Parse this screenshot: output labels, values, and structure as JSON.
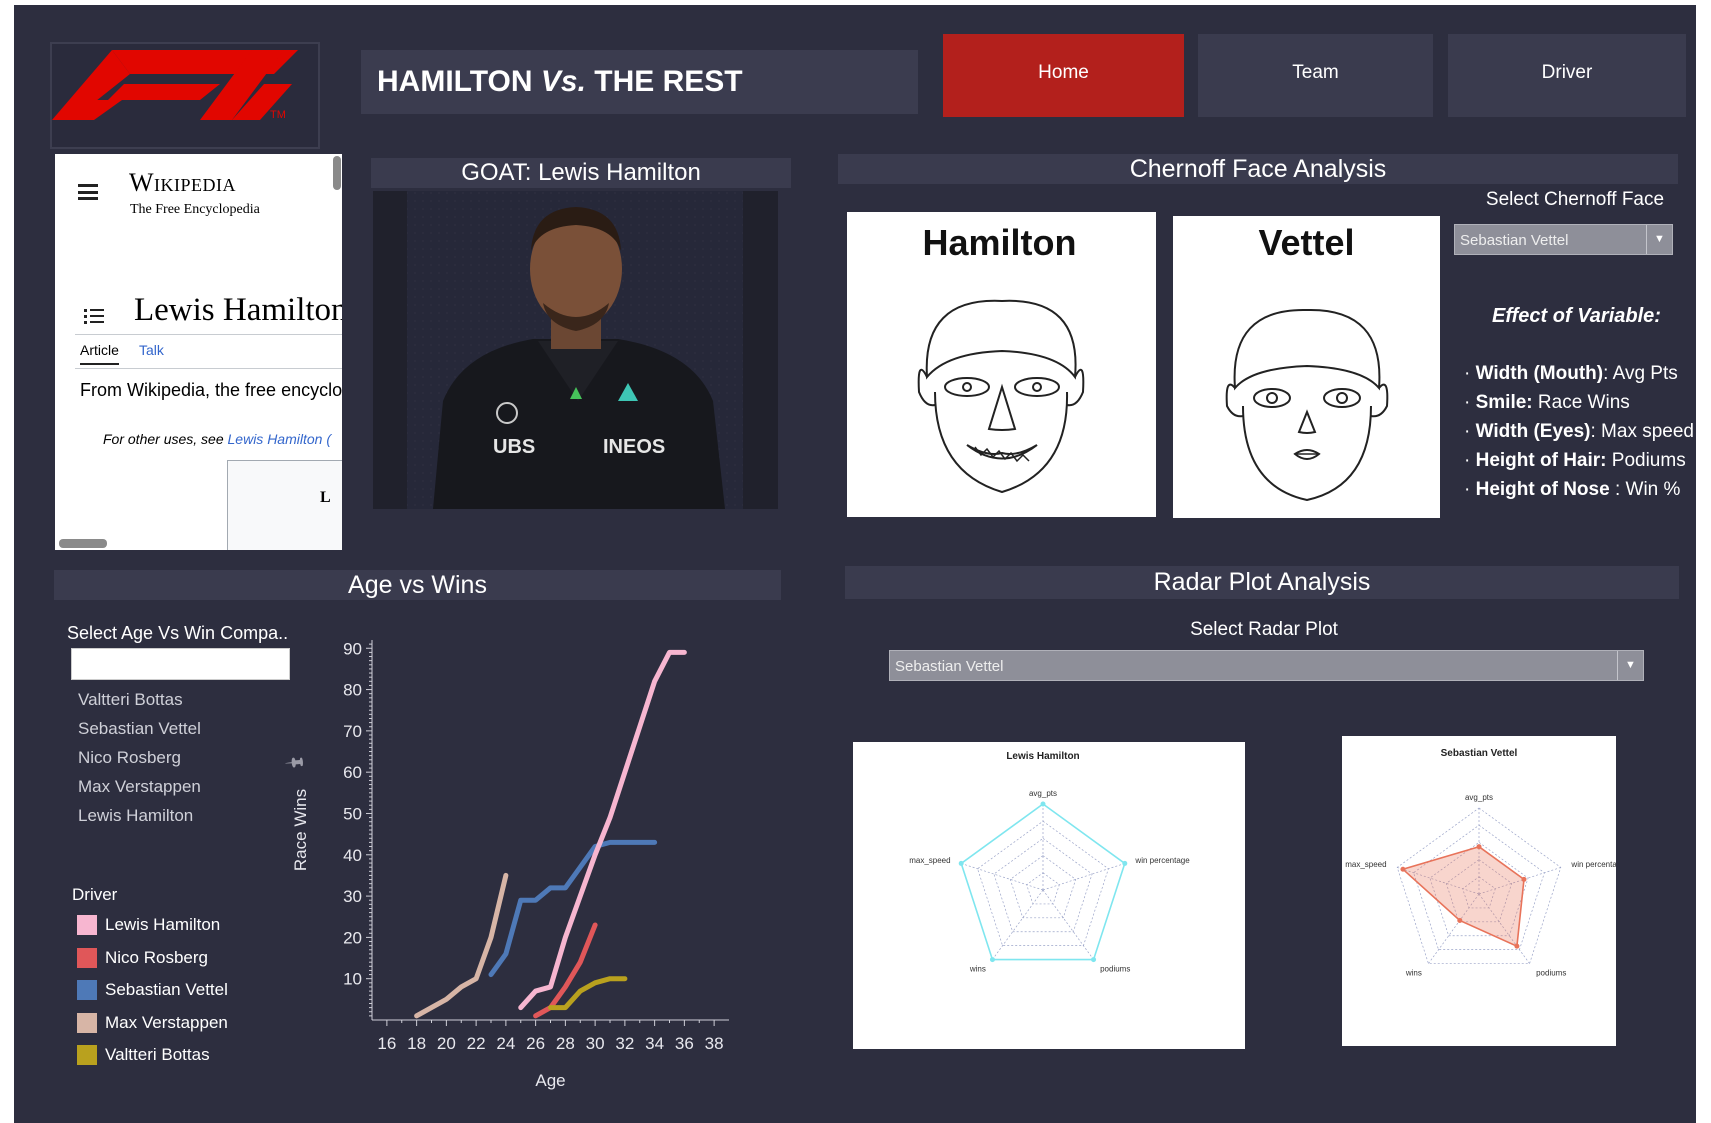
{
  "header": {
    "logo_text": "F1",
    "logo_tm": "TM",
    "title_prefix": "HAMILTON",
    "title_vs": "Vs.",
    "title_suffix": "THE REST"
  },
  "nav": {
    "home": "Home",
    "team": "Team",
    "driver": "Driver",
    "active_color": "#b3201c",
    "inactive_color": "#3a3b4e"
  },
  "wikipedia": {
    "brand": "Wikipedia",
    "tagline": "The Free Encyclopedia",
    "article_title": "Lewis Hamilton",
    "tab_article": "Article",
    "tab_talk": "Talk",
    "from_text": "From Wikipedia, the free encyclop",
    "other_uses_prefix": "For other uses, see ",
    "other_uses_link": "Lewis Hamilton (",
    "box_letter": "L"
  },
  "goat": {
    "heading": "GOAT: Lewis Hamilton",
    "suit_text_1": "UBS",
    "suit_text_2": "INEOS"
  },
  "chernoff": {
    "heading": "Chernoff Face Analysis",
    "face_left_name": "Hamilton",
    "face_right_name": "Vettel",
    "select_label": "Select Chernoff Face",
    "select_value": "Sebastian Vettel",
    "effect_heading": "Effect of Variable:",
    "variables": [
      {
        "bold": "Width (Mouth)",
        "rest": ": Avg Pts"
      },
      {
        "bold": "Smile:",
        "rest": " Race Wins"
      },
      {
        "bold": "Width (Eyes)",
        "rest": ": Max speed"
      },
      {
        "bold": "Height of Hair:",
        "rest": " Podiums"
      },
      {
        "bold": "Height of Nose",
        "rest": " : Win %"
      }
    ]
  },
  "age_wins": {
    "heading": "Age vs Wins",
    "filter_label": "Select Age Vs Win Compa..",
    "filter_input_value": "",
    "filter_items": [
      "Valtteri Bottas",
      "Sebastian Vettel",
      "Nico Rosberg",
      "Max Verstappen",
      "Lewis Hamilton"
    ],
    "legend_title": "Driver",
    "legend": [
      {
        "name": "Lewis Hamilton",
        "color": "#f7b6d0"
      },
      {
        "name": "Nico Rosberg",
        "color": "#e05759"
      },
      {
        "name": "Sebastian Vettel",
        "color": "#4e79b7"
      },
      {
        "name": "Max Verstappen",
        "color": "#d7b5a6"
      },
      {
        "name": "Valtteri Bottas",
        "color": "#b9a11e"
      }
    ]
  },
  "chart_data": {
    "type": "line",
    "title": "",
    "xlabel": "Age",
    "ylabel": "Race Wins",
    "xlim": [
      15,
      39
    ],
    "ylim": [
      0,
      92
    ],
    "x_ticks": [
      16,
      18,
      20,
      22,
      24,
      26,
      28,
      30,
      32,
      34,
      36,
      38
    ],
    "y_ticks": [
      10,
      20,
      30,
      40,
      50,
      60,
      70,
      80,
      90
    ],
    "grid": false,
    "legend_placement": "left",
    "series": [
      {
        "name": "Max Verstappen",
        "color": "#d7b5a6",
        "x": [
          18,
          19,
          20,
          21,
          22,
          23,
          24
        ],
        "y": [
          1,
          3,
          5,
          8,
          10,
          20,
          35
        ]
      },
      {
        "name": "Sebastian Vettel",
        "color": "#4e79b7",
        "x": [
          23,
          24,
          25,
          26,
          27,
          28,
          29,
          30,
          31,
          32,
          33,
          34
        ],
        "y": [
          11,
          16,
          29,
          29,
          32,
          32,
          37,
          42,
          43,
          43,
          43,
          43
        ]
      },
      {
        "name": "Lewis Hamilton",
        "color": "#f7b6d0",
        "x": [
          25,
          26,
          27,
          28,
          29,
          30,
          31,
          32,
          33,
          34,
          35,
          36
        ],
        "y": [
          3,
          7,
          8,
          20,
          30,
          40,
          49,
          60,
          71,
          82,
          89,
          89
        ]
      },
      {
        "name": "Nico Rosberg",
        "color": "#e05759",
        "x": [
          26,
          27,
          28,
          29,
          30
        ],
        "y": [
          1,
          3,
          8,
          14,
          23
        ]
      },
      {
        "name": "Valtteri Bottas",
        "color": "#b9a11e",
        "x": [
          27,
          28,
          29,
          30,
          31,
          32
        ],
        "y": [
          3,
          3,
          7,
          9,
          10,
          10
        ]
      }
    ]
  },
  "radar": {
    "heading": "Radar Plot Analysis",
    "select_label": "Select Radar Plot",
    "select_value": "Sebastian Vettel",
    "axes": [
      "avg_pts",
      "win percentage",
      "podiums",
      "wins",
      "max_speed"
    ],
    "left": {
      "title": "Lewis Hamilton",
      "color": "#7fe6ef",
      "values": [
        1.0,
        1.0,
        1.0,
        1.0,
        1.0
      ]
    },
    "right": {
      "title": "Sebastian Vettel",
      "color": "#e8735a",
      "values": [
        0.55,
        0.55,
        0.75,
        0.38,
        0.93
      ]
    }
  }
}
